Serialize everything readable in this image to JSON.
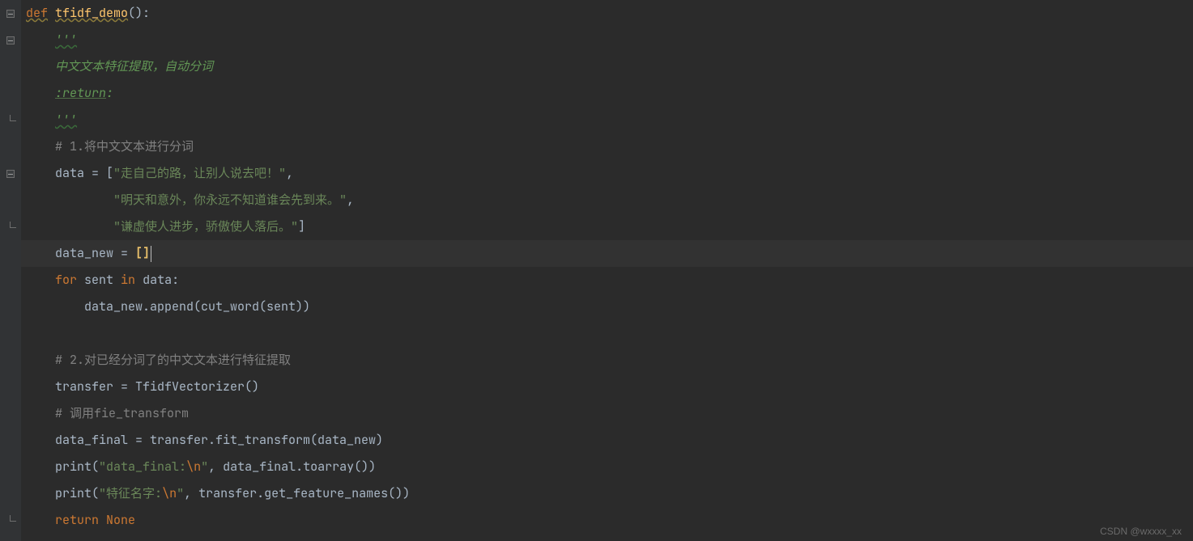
{
  "code": {
    "l1_def": "def",
    "l1_fn": "tfidf_demo",
    "l1_paren": "():",
    "l2_doc": "'''",
    "l3_doc": "中文文本特征提取，自动分词",
    "l4_tag": ":return",
    "l4_tag2": ":",
    "l5_doc": "'''",
    "l6_comment": "# 1.将中文文本进行分词",
    "l7a": "data = ",
    "l7b": "[",
    "l7c": "\"走自己的路，让别人说去吧！\"",
    "l7d": ",",
    "l8a": "\"明天和意外，你永远不知道谁会先到来。\"",
    "l8b": ",",
    "l9a": "\"谦虚使人进步，骄傲使人落后。\"",
    "l9b": "]",
    "l10a": "data_new = ",
    "l10b": "[]",
    "l11_for": "for",
    "l11_mid": " sent ",
    "l11_in": "in",
    "l11_end": " data:",
    "l12a": "data_new.append(cut_word(sent))",
    "l14_comment": "# 2.对已经分词了的中文文本进行特征提取",
    "l15": "transfer = TfidfVectorizer()",
    "l16_comment": "# 调用fie_transform",
    "l17": "data_final = transfer.fit_transform(data_new)",
    "l18_p": "print",
    "l18_a": "(",
    "l18_s": "\"data_final:",
    "l18_esc": "\\n",
    "l18_s2": "\"",
    "l18_b": ", data_final.toarray())",
    "l19_p": "print",
    "l19_a": "(",
    "l19_s": "\"特征名字:",
    "l19_esc": "\\n",
    "l19_s2": "\"",
    "l19_b": ", transfer.get_feature_names())",
    "l20_ret": "return ",
    "l20_none": "None"
  },
  "watermark": "CSDN @wxxxx_xx"
}
